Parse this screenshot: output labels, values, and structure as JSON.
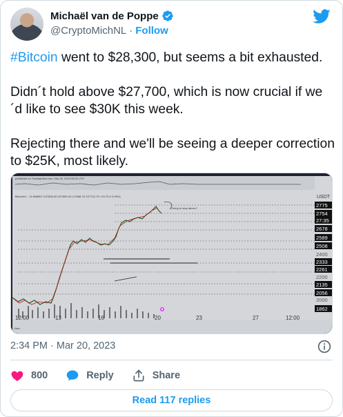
{
  "author": {
    "name": "Michaël van de Poppe",
    "handle": "@CryptoMichNL",
    "separator": "·",
    "follow_label": "Follow"
  },
  "tweet": {
    "hashtag": "#Bitcoin",
    "line1_rest": " went to $28,300, but seems a bit exhausted.",
    "paragraph2": "Didn´t hold above $27,700, which is now crucial if we ´d like to see $30K this week.",
    "paragraph3": "Rejecting there and we'll be seeing a deeper correction to $25K, most likely."
  },
  "chart": {
    "header_text": "published on TradingView.com, Mar 20, 2023 06:32 UTC",
    "symbol_text": "Bitcoin/U... 1h  BitMEX  O27836.00 H27892.00 L27668.75 C27741.75 +23.79 (+0.09%)",
    "annotation": "Going to stay above?",
    "currency": "USDT",
    "price_labels": [
      "2775",
      "2754",
      "27:35",
      "2678",
      "2589",
      "2508",
      "2400",
      "2333",
      "2261",
      "2200",
      "2135",
      "2056",
      "2000",
      "1862"
    ],
    "x_labels": [
      "12:00",
      "13",
      "16",
      "20",
      "23",
      "27",
      "12:00"
    ],
    "footer_text": "View"
  },
  "meta": {
    "timestamp": "2:34 PM · Mar 20, 2023"
  },
  "actions": {
    "likes": "800",
    "reply_label": "Reply",
    "share_label": "Share"
  },
  "replies_button": "Read 117 replies",
  "colors": {
    "accent": "#1d9bf0",
    "like": "#f91880",
    "text": "#0f1419",
    "muted": "#536471"
  }
}
